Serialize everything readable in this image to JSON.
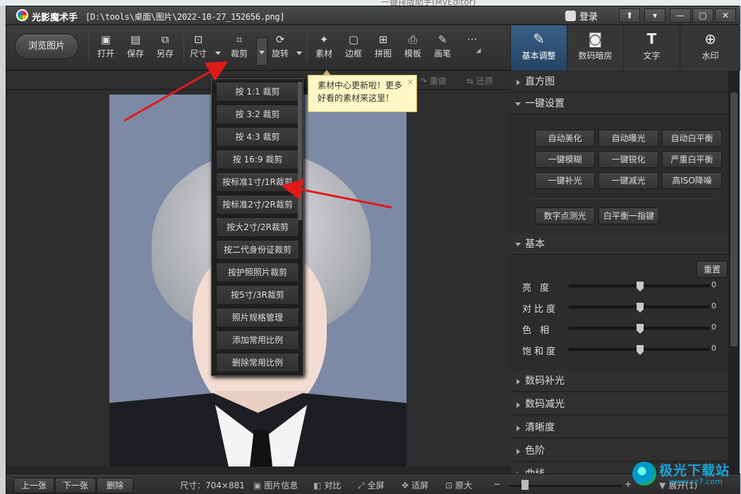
{
  "desktop": {
    "top_text": "一键排版助手(MyEditor)"
  },
  "window": {
    "app_title": "光影魔术手",
    "file_path": "[D:\\tools\\桌面\\图片\\2022-10-27_152656.png]",
    "login_label": "登录",
    "controls": [
      "⬆",
      "▾",
      "—",
      "▢",
      "✕"
    ]
  },
  "toolbar": {
    "browse_label": "浏览图片",
    "tools": [
      {
        "label": "打开",
        "icon": "open-icon"
      },
      {
        "label": "保存",
        "icon": "save-icon"
      },
      {
        "label": "另存",
        "icon": "save-as-icon"
      },
      {
        "label": "尺寸",
        "icon": "resize-icon"
      },
      {
        "label": "裁剪",
        "icon": "crop-icon"
      },
      {
        "label": "旋转",
        "icon": "rotate-icon"
      },
      {
        "label": "素材",
        "icon": "material-icon"
      },
      {
        "label": "边框",
        "icon": "border-icon"
      },
      {
        "label": "拼图",
        "icon": "collage-icon"
      },
      {
        "label": "模板",
        "icon": "template-icon"
      },
      {
        "label": "画笔",
        "icon": "brush-icon"
      }
    ],
    "more": "···",
    "redo_label": "重做",
    "restore_label": "还原"
  },
  "crop_menu": {
    "items": [
      "按 1:1 裁剪",
      "按 3:2 裁剪",
      "按 4:3 裁剪",
      "按 16:9 裁剪",
      "按标准1寸/1R裁剪",
      "按标准2寸/2R裁剪",
      "按大2寸/2R裁剪",
      "按二代身份证裁剪",
      "按护照照片裁剪",
      "按5寸/3R裁剪",
      "照片规格管理",
      "添加常用比例",
      "删除常用比例"
    ]
  },
  "tooltip": {
    "line1": "素材中心更新啦！更多",
    "line2": "好看的素材来这里！",
    "close": "✕"
  },
  "right_tabs": [
    {
      "label": "基本调整",
      "icon": "basic-adjust-icon",
      "active": true
    },
    {
      "label": "数码暗房",
      "icon": "darkroom-icon",
      "active": false
    },
    {
      "label": "文字",
      "icon": "text-icon",
      "active": false
    },
    {
      "label": "水印",
      "icon": "watermark-icon",
      "active": false
    }
  ],
  "right_panel": {
    "sections": {
      "histogram": "直方图",
      "one_click": "一键设置",
      "basic": "基本",
      "digital_fill": "数码补光",
      "digital_reduce": "数码减光",
      "clarity": "清晰度",
      "levels": "色阶",
      "curves": "曲线"
    },
    "one_click_buttons": [
      "自动美化",
      "自动曝光",
      "自动白平衡",
      "一键模糊",
      "一键锐化",
      "严重白平衡",
      "一键补光",
      "一键减光",
      "高ISO降噪",
      "数字点测光",
      "白平衡一指键"
    ],
    "reset_label": "重置",
    "sliders": [
      {
        "label": "亮  度",
        "value": "0",
        "level": 0.5
      },
      {
        "label": "对比度",
        "value": "0",
        "level": 0.5
      },
      {
        "label": "色  相",
        "value": "0",
        "level": 0.5
      },
      {
        "label": "饱和度",
        "value": "0",
        "level": 0.5
      }
    ]
  },
  "bottom_bar": {
    "prev": "上一张",
    "next": "下一张",
    "delete": "删除",
    "size_label": "尺寸：704×881",
    "info": "图片信息",
    "compare": "对比",
    "fullscreen": "全屏",
    "fit": "适屏",
    "original": "原大",
    "minus": "−",
    "plus": "+",
    "expand": "展开(1)"
  },
  "watermark": {
    "text": "极光下载站",
    "url": "www.xz7.com"
  }
}
